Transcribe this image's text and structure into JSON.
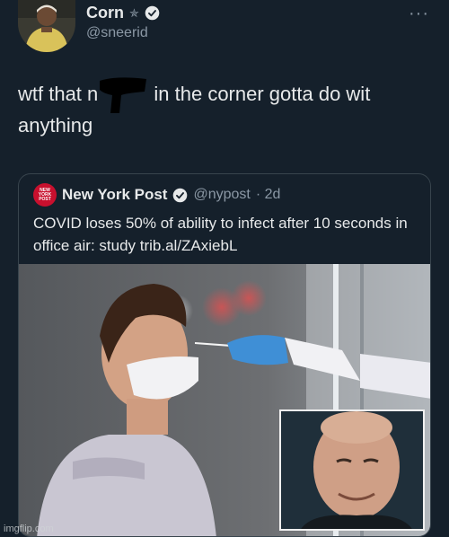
{
  "author": {
    "name": "Corn",
    "handle": "@sneerid",
    "badges": [
      "star-icon",
      "verified-icon"
    ],
    "avatar": "avatar"
  },
  "menu_icon": "more-icon",
  "tweet": {
    "text_part1": "wtf that n",
    "text_part2": " in the corner gotta do wit anythi",
    "text_part3": "ng"
  },
  "quoted": {
    "name": "New York Post",
    "handle": "@nypost",
    "time": "· 2d",
    "logo_text_1": "NEW",
    "logo_text_2": "YORK",
    "logo_text_3": "POST",
    "text": "COVID loses 50% of ability to infect after 10 seconds in office air: study trib.al/ZAxiebL"
  },
  "watermark": "imgflip.com",
  "colors": {
    "background": "#15202b",
    "verified": "#1d9bf0",
    "nypost_red": "#c8102e",
    "muted": "#8b98a5",
    "text": "#e7e9ea"
  }
}
